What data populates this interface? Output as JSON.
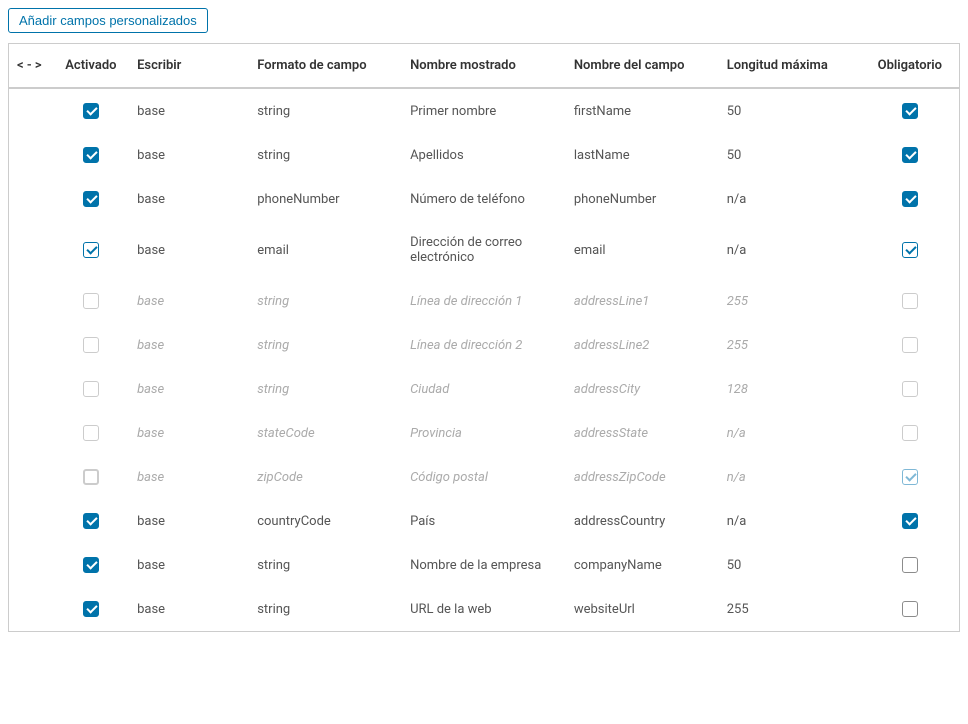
{
  "buttons": {
    "add_custom_fields": "Añadir campos personalizados"
  },
  "headers": {
    "drag": "< - >",
    "activado": "Activado",
    "escribir": "Escribir",
    "formato": "Formato de campo",
    "nombre_mostrado": "Nombre mostrado",
    "nombre_campo": "Nombre del campo",
    "longitud": "Longitud máxima",
    "obligatorio": "Obligatorio"
  },
  "rows": [
    {
      "activado": true,
      "escribir": "base",
      "formato": "string",
      "nombre_m": "Primer nombre",
      "nombre_c": "firstName",
      "longitud": "50",
      "oblig": true,
      "inactive": false,
      "act_style": "checked",
      "oblig_style": "checked"
    },
    {
      "activado": true,
      "escribir": "base",
      "formato": "string",
      "nombre_m": "Apellidos",
      "nombre_c": "lastName",
      "longitud": "50",
      "oblig": true,
      "inactive": false,
      "act_style": "checked",
      "oblig_style": "checked"
    },
    {
      "activado": true,
      "escribir": "base",
      "formato": "phoneNumber",
      "nombre_m": "Número de teléfono",
      "nombre_c": "phoneNumber",
      "longitud": "n/a",
      "oblig": true,
      "inactive": false,
      "act_style": "checked",
      "oblig_style": "checked"
    },
    {
      "activado": true,
      "escribir": "base",
      "formato": "email",
      "nombre_m": "Dirección de correo electrónico",
      "nombre_c": "email",
      "longitud": "n/a",
      "oblig": true,
      "inactive": false,
      "act_style": "checked light",
      "oblig_style": "checked light"
    },
    {
      "activado": false,
      "escribir": "base",
      "formato": "string",
      "nombre_m": "Línea de dirección 1",
      "nombre_c": "addressLine1",
      "longitud": "255",
      "oblig": false,
      "inactive": true,
      "act_style": "",
      "oblig_style": ""
    },
    {
      "activado": false,
      "escribir": "base",
      "formato": "string",
      "nombre_m": "Línea de dirección 2",
      "nombre_c": "addressLine2",
      "longitud": "255",
      "oblig": false,
      "inactive": true,
      "act_style": "",
      "oblig_style": ""
    },
    {
      "activado": false,
      "escribir": "base",
      "formato": "string",
      "nombre_m": "Ciudad",
      "nombre_c": "addressCity",
      "longitud": "128",
      "oblig": false,
      "inactive": true,
      "act_style": "",
      "oblig_style": ""
    },
    {
      "activado": false,
      "escribir": "base",
      "formato": "stateCode",
      "nombre_m": "Provincia",
      "nombre_c": "addressState",
      "longitud": "n/a",
      "oblig": false,
      "inactive": true,
      "act_style": "",
      "oblig_style": ""
    },
    {
      "activado": false,
      "escribir": "base",
      "formato": "zipCode",
      "nombre_m": "Código postal",
      "nombre_c": "addressZipCode",
      "longitud": "n/a",
      "oblig": true,
      "inactive": true,
      "act_style": "focus",
      "oblig_style": "checked light"
    },
    {
      "activado": true,
      "escribir": "base",
      "formato": "countryCode",
      "nombre_m": "País",
      "nombre_c": "addressCountry",
      "longitud": "n/a",
      "oblig": true,
      "inactive": false,
      "act_style": "checked",
      "oblig_style": "checked"
    },
    {
      "activado": true,
      "escribir": "base",
      "formato": "string",
      "nombre_m": "Nombre de la empresa",
      "nombre_c": "companyName",
      "longitud": "50",
      "oblig": false,
      "inactive": false,
      "act_style": "checked",
      "oblig_style": ""
    },
    {
      "activado": true,
      "escribir": "base",
      "formato": "string",
      "nombre_m": "URL de la web",
      "nombre_c": "websiteUrl",
      "longitud": "255",
      "oblig": false,
      "inactive": false,
      "act_style": "checked",
      "oblig_style": ""
    }
  ]
}
